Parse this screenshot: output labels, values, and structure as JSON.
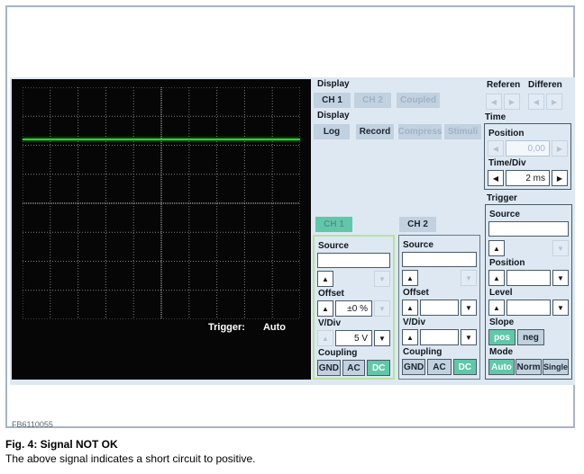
{
  "icons": {
    "up": "▲",
    "down": "▼",
    "left": "◀",
    "right": "▶"
  },
  "colors": {
    "accent_teal": "#60c8a8",
    "signal_green": "#2fd02f",
    "panel_blue": "#dde8f2"
  },
  "scope": {
    "grid_cols": 10,
    "grid_rows": 8,
    "signal": {
      "type": "flat-line",
      "position_divisions_from_top": 1.8
    },
    "status": {
      "trigger_label": "Trigger:",
      "trigger_value": "Auto"
    }
  },
  "display_channels": {
    "label": "Display",
    "buttons": [
      {
        "label": "CH 1",
        "enabled": true
      },
      {
        "label": "CH 2",
        "enabled": false
      },
      {
        "label": "Coupled",
        "enabled": false
      }
    ]
  },
  "display_modes": {
    "label": "Display",
    "buttons": [
      {
        "label": "Log",
        "enabled": true
      },
      {
        "label": "Record",
        "enabled": true
      },
      {
        "label": "Compress",
        "enabled": false
      },
      {
        "label": "Stimuli",
        "enabled": false
      }
    ]
  },
  "reference_nav": {
    "referen_label": "Referen",
    "differen_label": "Differen"
  },
  "time_panel": {
    "label": "Time",
    "position": {
      "label": "Position",
      "value": "0,00"
    },
    "time_div": {
      "label": "Time/Div",
      "value": "2 ms"
    }
  },
  "trigger_panel": {
    "label": "Trigger",
    "source": {
      "label": "Source",
      "value": ""
    },
    "position": {
      "label": "Position",
      "value": ""
    },
    "level": {
      "label": "Level",
      "value": ""
    },
    "slope": {
      "label": "Slope",
      "options": [
        {
          "label": "pos",
          "selected": true
        },
        {
          "label": "neg",
          "selected": false
        }
      ]
    },
    "mode": {
      "label": "Mode",
      "options": [
        {
          "label": "Auto",
          "selected": true
        },
        {
          "label": "Norm",
          "selected": false
        },
        {
          "label": "Single",
          "selected": false
        }
      ]
    }
  },
  "channel1": {
    "tab": "CH 1",
    "source": {
      "label": "Source",
      "value": ""
    },
    "offset": {
      "label": "Offset",
      "value": "±0 %"
    },
    "v_div": {
      "label": "V/Div",
      "value": "5 V"
    },
    "coupling": {
      "label": "Coupling",
      "options": [
        {
          "label": "GND",
          "selected": false
        },
        {
          "label": "AC",
          "selected": false
        },
        {
          "label": "DC",
          "selected": true
        }
      ]
    }
  },
  "channel2": {
    "tab": "CH 2",
    "source": {
      "label": "Source",
      "value": ""
    },
    "offset": {
      "label": "Offset",
      "value": ""
    },
    "v_div": {
      "label": "V/Div",
      "value": ""
    },
    "coupling": {
      "label": "Coupling",
      "options": [
        {
          "label": "GND",
          "selected": false
        },
        {
          "label": "AC",
          "selected": false
        },
        {
          "label": "DC",
          "selected": true
        }
      ]
    }
  },
  "figure": {
    "code": "FB6110055",
    "caption_title": "Fig. 4: Signal NOT OK",
    "caption_text": "The above signal indicates a short circuit to positive."
  }
}
